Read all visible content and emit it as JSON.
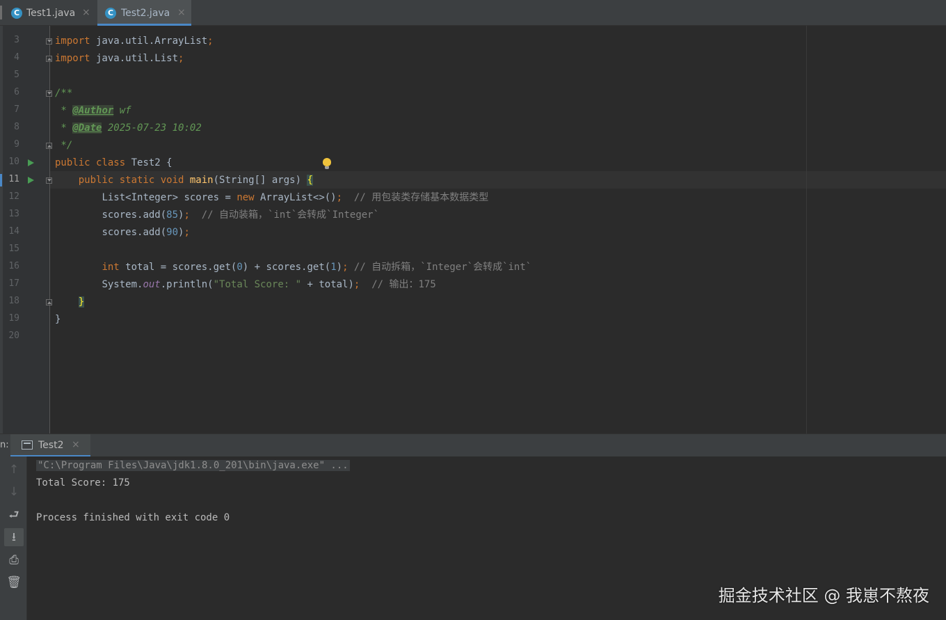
{
  "tabs": [
    {
      "icon": "C",
      "label": "Test1.java",
      "close": "×"
    },
    {
      "icon": "C",
      "label": "Test2.java",
      "close": "×"
    }
  ],
  "editor": {
    "line_numbers": [
      "3",
      "4",
      "5",
      "6",
      "7",
      "8",
      "9",
      "10",
      "11",
      "12",
      "13",
      "14",
      "15",
      "16",
      "17",
      "18",
      "19",
      "20"
    ],
    "current_line": "11",
    "code": {
      "l3": {
        "kw": "import",
        "rest": " java.util.ArrayList",
        "semi": ";"
      },
      "l4": {
        "kw": "import",
        "rest": " java.util.List",
        "semi": ";"
      },
      "l6": "/**",
      "l7": {
        "star": " * ",
        "tag": "@Author",
        "val": " wf"
      },
      "l8": {
        "star": " * ",
        "tag": "@Date",
        "val": " 2025-07-23 10:02"
      },
      "l9": " */",
      "l10": {
        "kw": "public class",
        "rest": " Test2 {"
      },
      "l11": {
        "kw1": "public static void",
        "fn": "main",
        "rest": "(String[] args) ",
        "brace": "{"
      },
      "l12": {
        "pre": "List<Integer> scores = ",
        "kw": "new",
        "post": " ArrayList<>()",
        "semi": ";",
        "comment": "  // 用包装类存储基本数据类型"
      },
      "l13": {
        "pre": "scores.add(",
        "num": "85",
        "post": ")",
        "semi": ";",
        "comment": "  // 自动装箱，`int`会转成`Integer`"
      },
      "l14": {
        "pre": "scores.add(",
        "num": "90",
        "post": ")",
        "semi": ";"
      },
      "l16": {
        "kw": "int",
        "pre": " total = scores.get(",
        "num1": "0",
        "mid": ") + scores.get(",
        "num2": "1",
        "post": ")",
        "semi": ";",
        "comment": " // 自动拆箱，`Integer`会转成`int`"
      },
      "l17": {
        "pre": "System.",
        "field": "out",
        "mid": ".println(",
        "str": "\"Total Score: \"",
        "post": " + total)",
        "semi": ";",
        "comment": "  // 输出：175"
      },
      "l18": "}",
      "l19": "}"
    }
  },
  "run": {
    "prefix": "n:",
    "tab_label": "Test2",
    "tab_close": "×",
    "toolbar": [
      "↑",
      "↓",
      "⮐",
      "⭳",
      "⎙",
      "🗑"
    ],
    "console": {
      "cmd": "\"C:\\Program Files\\Java\\jdk1.8.0_201\\bin\\java.exe\" ...",
      "output": "Total Score: 175",
      "exit": "Process finished with exit code 0"
    }
  },
  "watermark": "掘金技术社区 @ 我崽不熬夜"
}
